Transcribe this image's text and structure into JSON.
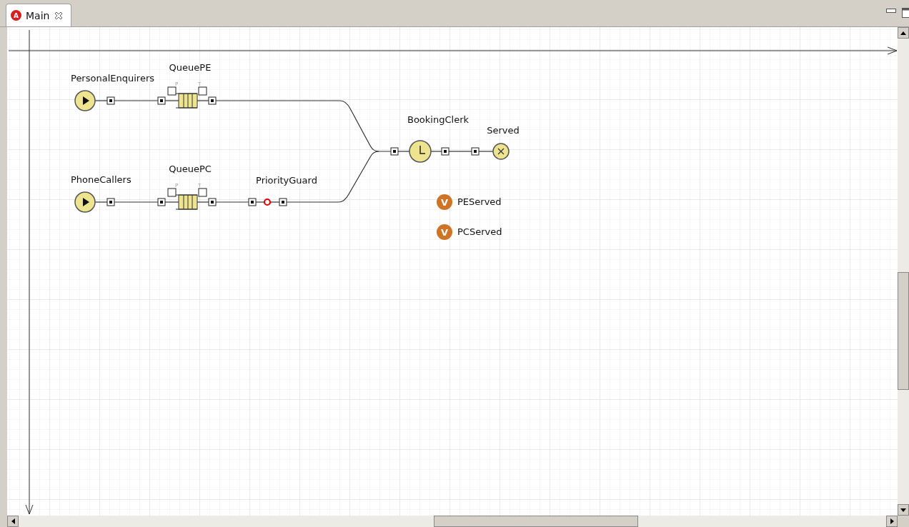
{
  "tabs": [
    {
      "label": "Main",
      "icon_letter": "A",
      "selected": true
    }
  ],
  "blocks": [
    {
      "kind": "source",
      "label": "PersonalEnquirers"
    },
    {
      "kind": "queue",
      "label": "QueuePE",
      "ports": [
        "P",
        "T"
      ]
    },
    {
      "kind": "source",
      "label": "PhoneCallers"
    },
    {
      "kind": "queue",
      "label": "QueuePC",
      "ports": [
        "P",
        "T"
      ]
    },
    {
      "kind": "hold",
      "label": "PriorityGuard"
    },
    {
      "kind": "service",
      "label": "BookingClerk"
    },
    {
      "kind": "sink",
      "label": "Served"
    }
  ],
  "variables": [
    {
      "icon": "V",
      "label": "PEServed"
    },
    {
      "icon": "V",
      "label": "PCServed"
    }
  ]
}
